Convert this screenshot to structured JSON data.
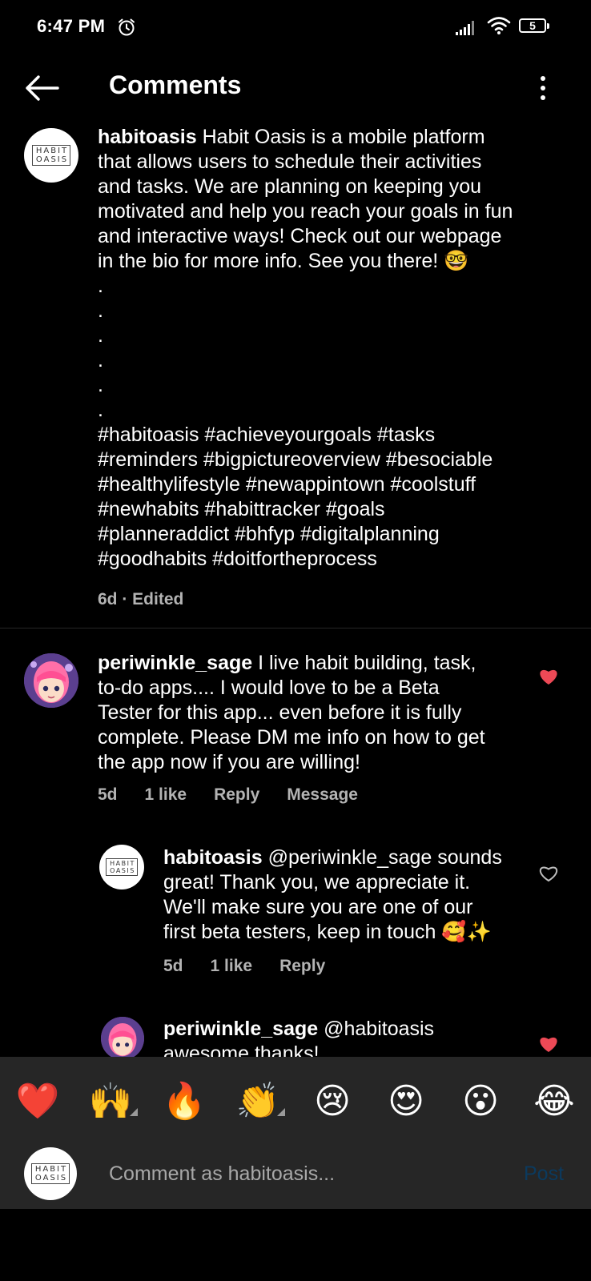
{
  "status_bar": {
    "time": "6:47 PM",
    "battery": "5",
    "icons": [
      "alarm-icon",
      "signal-icon",
      "wifi-icon",
      "battery-icon"
    ]
  },
  "header": {
    "title": "Comments",
    "back_icon": "arrow-left-icon",
    "more_icon": "more-vertical-icon"
  },
  "logo_text": [
    "HABIT",
    "OASIS"
  ],
  "caption": {
    "username": "habitoasis",
    "lines": [
      "Habit Oasis is a mobile platform",
      "that allows users to schedule their activities",
      "and tasks. We are planning on keeping you",
      "motivated and help you reach your goals in fun",
      "and interactive ways! Check out our webpage",
      "in the bio for more info. See you there! 🤓"
    ],
    "dots": [
      ".",
      ".",
      ".",
      ".",
      ".",
      "."
    ],
    "hashtags": [
      "#habitoasis #achieveyourgoals #tasks",
      "#reminders #bigpictureoverview #besociable",
      "#healthylifestyle #newappintown #coolstuff",
      "#newhabits #habittracker #goals",
      "#planneraddict #bhfyp #digitalplanning",
      "#goodhabits #doitfortheprocess"
    ],
    "meta": "6d · Edited"
  },
  "comments": [
    {
      "username": "periwinkle_sage",
      "lines": [
        "I live habit building,  task,",
        "to-do apps.... I would love to be a Beta",
        "Tester for this app... even before it is fully",
        "complete.  Please DM me info on how to get",
        "the app now if you are willing!"
      ],
      "time": "5d",
      "likes": "1 like",
      "reply": "Reply",
      "message": "Message",
      "liked": true
    },
    {
      "username": "habitoasis",
      "lines": [
        "@periwinkle_sage sounds",
        "great! Thank you, we appreciate it.",
        "We'll make sure you are one of our",
        "first beta testers, keep in touch 🥰✨"
      ],
      "time": "5d",
      "likes": "1 like",
      "reply": "Reply",
      "liked": false
    },
    {
      "username": "periwinkle_sage",
      "lines": [
        "@habitoasis",
        "awesome thanks!"
      ],
      "liked": true
    }
  ],
  "reactions": [
    "❤️",
    "🙌",
    "🔥",
    "👏",
    "😢",
    "😍",
    "😮",
    "😂"
  ],
  "composer": {
    "placeholder": "Comment as habitoasis...",
    "post_label": "Post"
  },
  "colors": {
    "background": "#000000",
    "liked_heart": "#ed4956",
    "meta_text": "#b3b3b3",
    "reaction_bar": "#262626",
    "post_disabled": "#0b3a5e"
  }
}
